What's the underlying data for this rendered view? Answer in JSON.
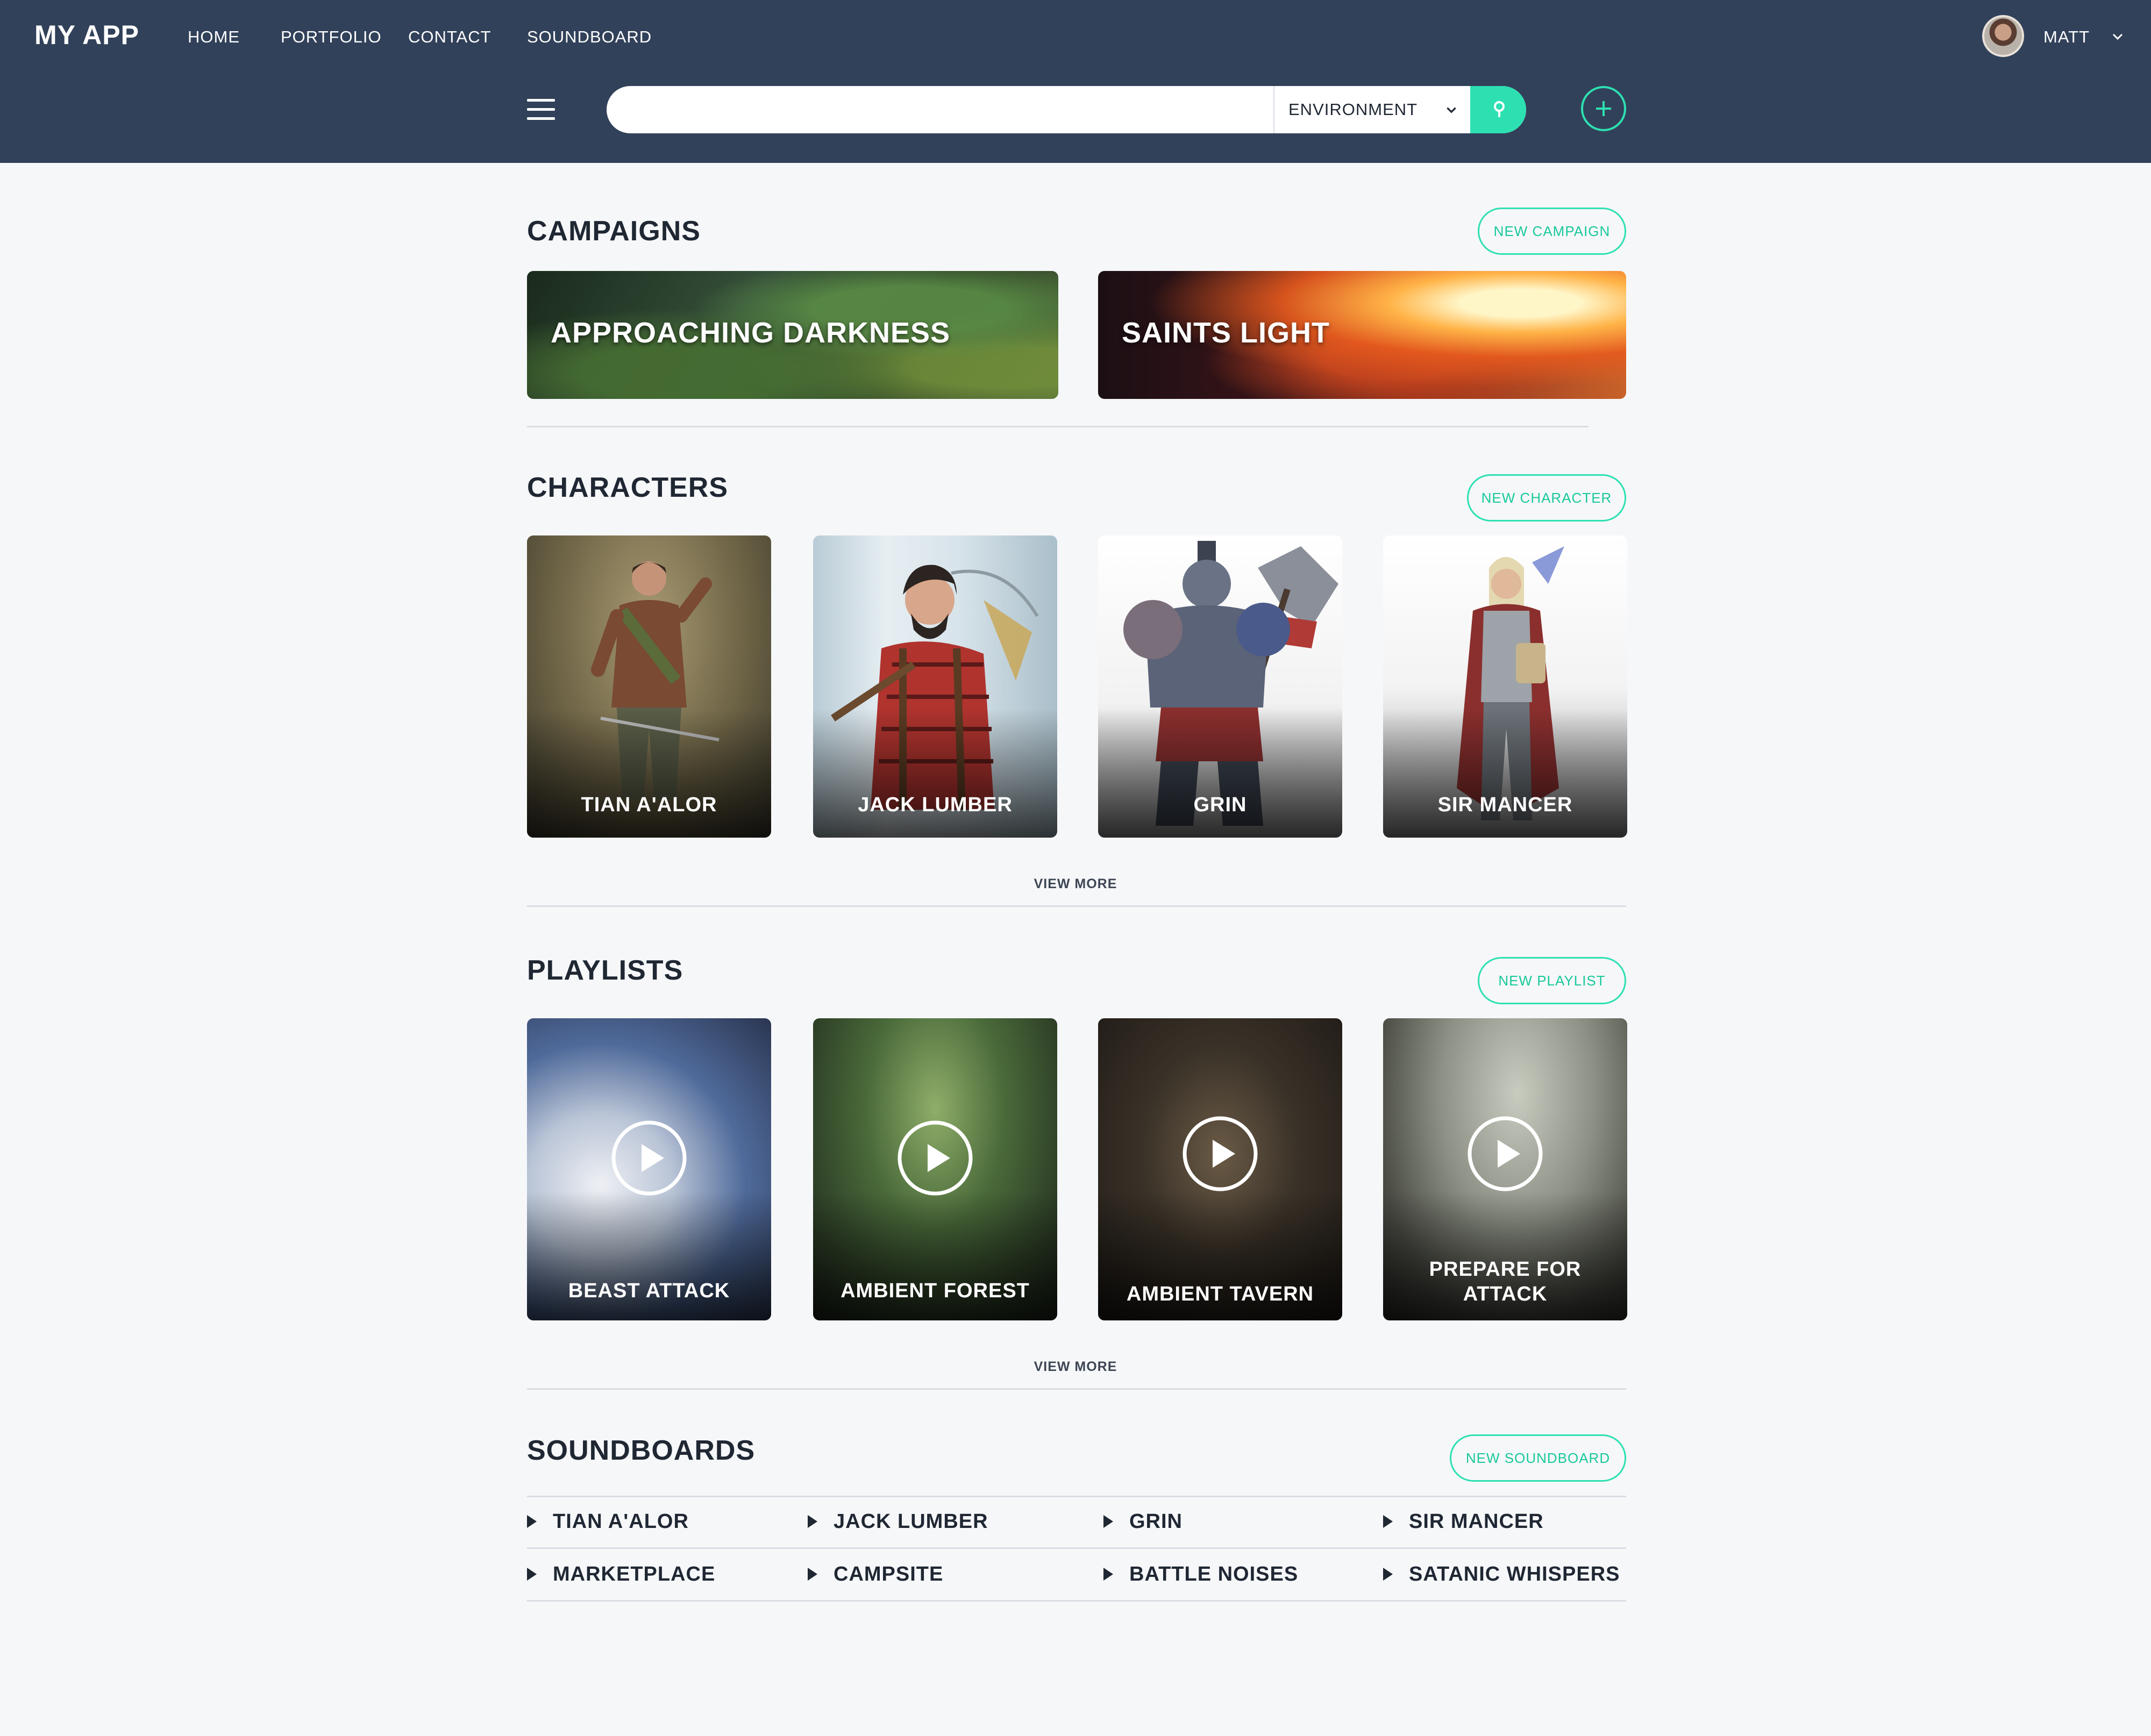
{
  "header": {
    "logo": "MY APP",
    "nav": [
      "HOME",
      "PORTFOLIO",
      "CONTACT",
      "SOUNDBOARD"
    ],
    "user_name": "MATT",
    "search": {
      "value": "",
      "category": "ENVIRONMENT"
    }
  },
  "campaigns": {
    "title": "CAMPAIGNS",
    "new_button": "NEW CAMPAIGN",
    "items": [
      "APPROACHING DARKNESS",
      "SAINTS LIGHT"
    ]
  },
  "characters": {
    "title": "CHARACTERS",
    "new_button": "NEW CHARACTER",
    "items": [
      "TIAN A'ALOR",
      "JACK LUMBER",
      "GRIN",
      "SIR MANCER"
    ],
    "view_more": "VIEW MORE"
  },
  "playlists": {
    "title": "PLAYLISTS",
    "new_button": "NEW PLAYLIST",
    "items": [
      "BEAST ATTACK",
      "AMBIENT FOREST",
      "AMBIENT TAVERN",
      "PREPARE FOR ATTACK"
    ],
    "view_more": "VIEW MORE"
  },
  "soundboards": {
    "title": "SOUNDBOARDS",
    "new_button": "NEW SOUNDBOARD",
    "items": [
      "TIAN A'ALOR",
      "JACK LUMBER",
      "GRIN",
      "SIR MANCER",
      "MARKETPLACE",
      "CAMPSITE",
      "BATTLE NOISES",
      "SATANIC WHISPERS"
    ]
  },
  "colors": {
    "header_bg": "#32415a",
    "accent": "#2de0b2",
    "page_bg": "#f6f7f9",
    "text": "#1f2733"
  },
  "icons": [
    "avatar",
    "chevron-down-icon",
    "menu-icon",
    "search-icon",
    "plus-icon",
    "play-icon",
    "triangle-play-icon"
  ]
}
